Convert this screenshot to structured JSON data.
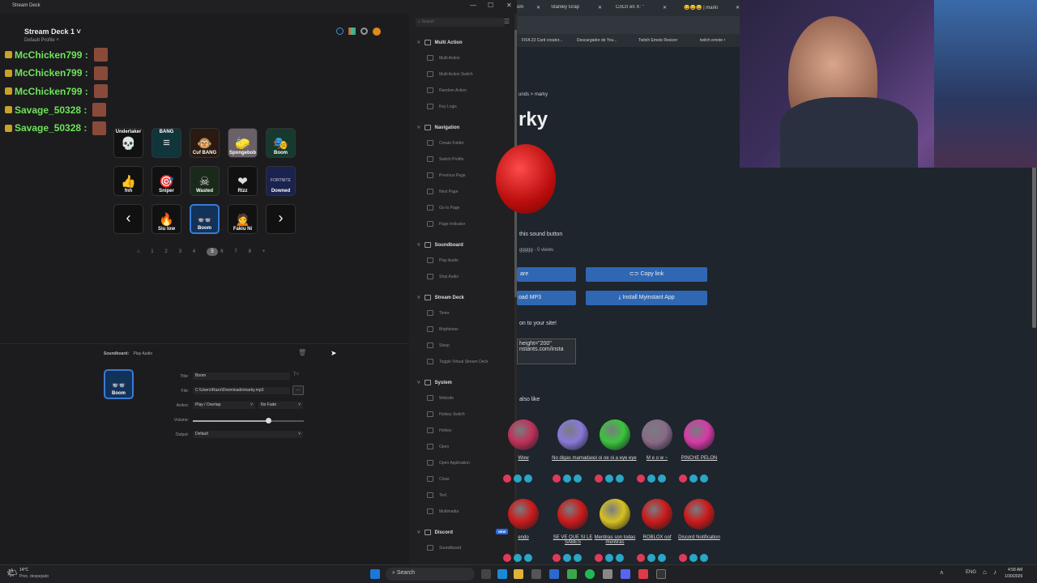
{
  "window": {
    "title": "Stream Deck"
  },
  "deck": {
    "name": "Stream Deck 1 ˅",
    "profile": "Default Profile ˅"
  },
  "chat": [
    {
      "user": "McChicken799 :"
    },
    {
      "user": "McChicken799 :"
    },
    {
      "user": "McChicken799 :"
    },
    {
      "user": "Savage_50328 :"
    },
    {
      "user": "Savage_50328 :"
    }
  ],
  "keys": [
    {
      "label": "Undertaker",
      "glyph": "💀",
      "bg": "#111"
    },
    {
      "label": "BANG",
      "glyph": "≡",
      "bg": "#10353a"
    },
    {
      "label": "Cuf BANG",
      "glyph": "🐵",
      "bg": "#2a1a12"
    },
    {
      "label": "Spongebob",
      "glyph": "🧽",
      "bg": "#6a6068"
    },
    {
      "label": "Boom",
      "glyph": "🎭",
      "bg": "#163a2e"
    },
    {
      "label": "fnh",
      "glyph": "👍",
      "bg": "#111"
    },
    {
      "label": "Sniper",
      "glyph": "🎯",
      "bg": "#111"
    },
    {
      "label": "Wasted",
      "glyph": "☠",
      "bg": "#1a2a1a"
    },
    {
      "label": "Rizz",
      "glyph": "❤",
      "bg": "#111"
    },
    {
      "label": "Downed",
      "glyph": "FORTNITE",
      "bg": "#1a2250"
    },
    {
      "label": "",
      "glyph": "‹",
      "bg": "#111"
    },
    {
      "label": "Siu low",
      "glyph": "🔥",
      "bg": "#111"
    },
    {
      "label": "Boom",
      "glyph": "👓",
      "bg": "#13325a"
    },
    {
      "label": "Fakiu Ni",
      "glyph": "🙍",
      "bg": "#111"
    },
    {
      "label": "",
      "glyph": "›",
      "bg": "#111"
    }
  ],
  "pages": [
    "⌂",
    "1",
    "2",
    "3",
    "4",
    "5",
    "6",
    "7",
    "8",
    "+"
  ],
  "current_page": "5",
  "props": {
    "breadcrumb_cat": "Soundboard:",
    "breadcrumb_action": "Play Audio",
    "key_label": "Boom",
    "title_label": "Title:",
    "title_value": "Boom",
    "file_label": "File:",
    "file_value": "C:\\Users\\Razo\\Downloads\\marky.mp3",
    "file_btn": "...",
    "action_label": "Action:",
    "action_value": "Play / Overlap",
    "fade_value": "No Fade",
    "volume_label": "Volume:",
    "volume": 0.68,
    "output_label": "Output:",
    "output_value": "Default"
  },
  "search": {
    "placeholder": "Search"
  },
  "action_groups": [
    {
      "name": "Multi Action",
      "items": [
        "Multi Action",
        "Multi Action Switch",
        "Random Action",
        "Key Logic"
      ]
    },
    {
      "name": "Navigation",
      "items": [
        "Create Folder",
        "Switch Profile",
        "Previous Page",
        "Next Page",
        "Go to Page",
        "Page Indicator"
      ]
    },
    {
      "name": "Soundboard",
      "items": [
        "Play Audio",
        "Stop Audio"
      ]
    },
    {
      "name": "Stream Deck",
      "items": [
        "Timer",
        "Brightness",
        "Sleep",
        "Toggle Virtual Stream Deck"
      ]
    },
    {
      "name": "System",
      "items": [
        "Website",
        "Hotkey Switch",
        "Hotkey",
        "Open",
        "Open Application",
        "Close",
        "Text",
        "Multimedia"
      ]
    },
    {
      "name": "Discord",
      "badge": "NEW",
      "items": [
        "Soundboard"
      ]
    }
  ],
  "browser": {
    "tabs": [
      "om",
      "Stanley Grap",
      "CnCn en X: \"",
      "😀😀😀 | marki"
    ],
    "bookmarks": [
      "FIFA 23 Card creator...",
      "Descargador de You...",
      "Twitch Emote Resizer",
      "twitch emote r"
    ],
    "breadcrumb": "unds > marky",
    "heading": "rky",
    "subtitle": "this sound button",
    "views": "ggggg - 0 views",
    "btn_share": "are",
    "btn_copy": "Copy link",
    "btn_mp3": "oad MP3",
    "btn_app": "Install Myinstant App",
    "embed_text": "on to your site!",
    "embed_code": "height=\"200\" nstants.com/insta",
    "also_like": "also like",
    "row1": [
      {
        "label": "Wow",
        "color": "#c0305a"
      },
      {
        "label": "No digas mamadas",
        "color": "#8a78d8"
      },
      {
        "label": "oi oi oe oi a eye eye",
        "color": "#3bc43b"
      },
      {
        "label": "M e o w ~",
        "color": "#8a6a88"
      },
      {
        "label": "PINCHE PELON",
        "color": "#d63aa6"
      }
    ],
    "row2": [
      {
        "label": "endo",
        "color": "#cc1a1a"
      },
      {
        "label": "SE VE QUE SI LE SABES",
        "color": "#cc1a1a"
      },
      {
        "label": "Mentiras son todas mentiras",
        "color": "#d8c020"
      },
      {
        "label": "ROBLOX oof",
        "color": "#cc1a1a"
      },
      {
        "label": "Discord Notification",
        "color": "#cc1a1a"
      }
    ]
  },
  "taskbar": {
    "weather_temp": "14°C",
    "weather_desc": "Prec. despejado",
    "search": "Search",
    "lang": "ENG",
    "time": "4:58 AM",
    "date": "1/30/2026"
  }
}
